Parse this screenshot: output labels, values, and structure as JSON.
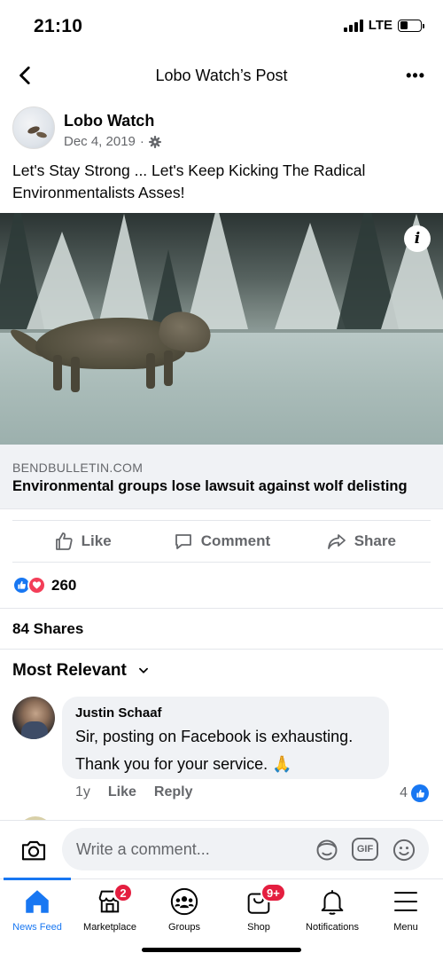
{
  "status_bar": {
    "time": "21:10",
    "network": "LTE",
    "battery_level": 0.4
  },
  "header": {
    "title": "Lobo Watch’s Post",
    "back_icon": "chevron-left-icon",
    "more_icon": "more-horizontal-icon"
  },
  "post": {
    "author": "Lobo Watch",
    "date": "Dec 4, 2019",
    "separator": "·",
    "privacy_icon": "gear-icon",
    "text": "Let's Stay Strong ... Let's Keep Kicking The Radical Environmentalists Asses!",
    "link": {
      "domain": "BENDBULLETIN.COM",
      "title": "Environmental groups lose lawsuit against wolf delisting",
      "info_icon": "info-icon"
    }
  },
  "actions": {
    "like": "Like",
    "comment": "Comment",
    "share": "Share"
  },
  "reactions": {
    "count": "260",
    "icons": [
      "like-reaction-icon",
      "love-reaction-icon"
    ]
  },
  "shares": "84 Shares",
  "comments_sort": "Most Relevant",
  "comment": {
    "author": "Justin Schaaf",
    "text_line1": "Sir, posting on Facebook is exhausting.",
    "text_line2": "Thank you for your service. 🙏",
    "age": "1y",
    "like_label": "Like",
    "reply_label": "Reply",
    "like_count": "4"
  },
  "composer": {
    "placeholder": "Write a comment...",
    "gif_label": "GIF"
  },
  "bottom_nav": {
    "items": [
      {
        "label": "News Feed",
        "icon": "home-icon",
        "active": true
      },
      {
        "label": "Marketplace",
        "icon": "marketplace-icon",
        "badge": "2"
      },
      {
        "label": "Groups",
        "icon": "groups-icon"
      },
      {
        "label": "Shop",
        "icon": "shop-icon",
        "badge": "9+"
      },
      {
        "label": "Notifications",
        "icon": "bell-icon"
      },
      {
        "label": "Menu",
        "icon": "menu-icon"
      }
    ]
  },
  "colors": {
    "accent": "#1877f2",
    "secondary_text": "#65676b",
    "love": "#f33e58",
    "badge": "#e41e3f"
  }
}
